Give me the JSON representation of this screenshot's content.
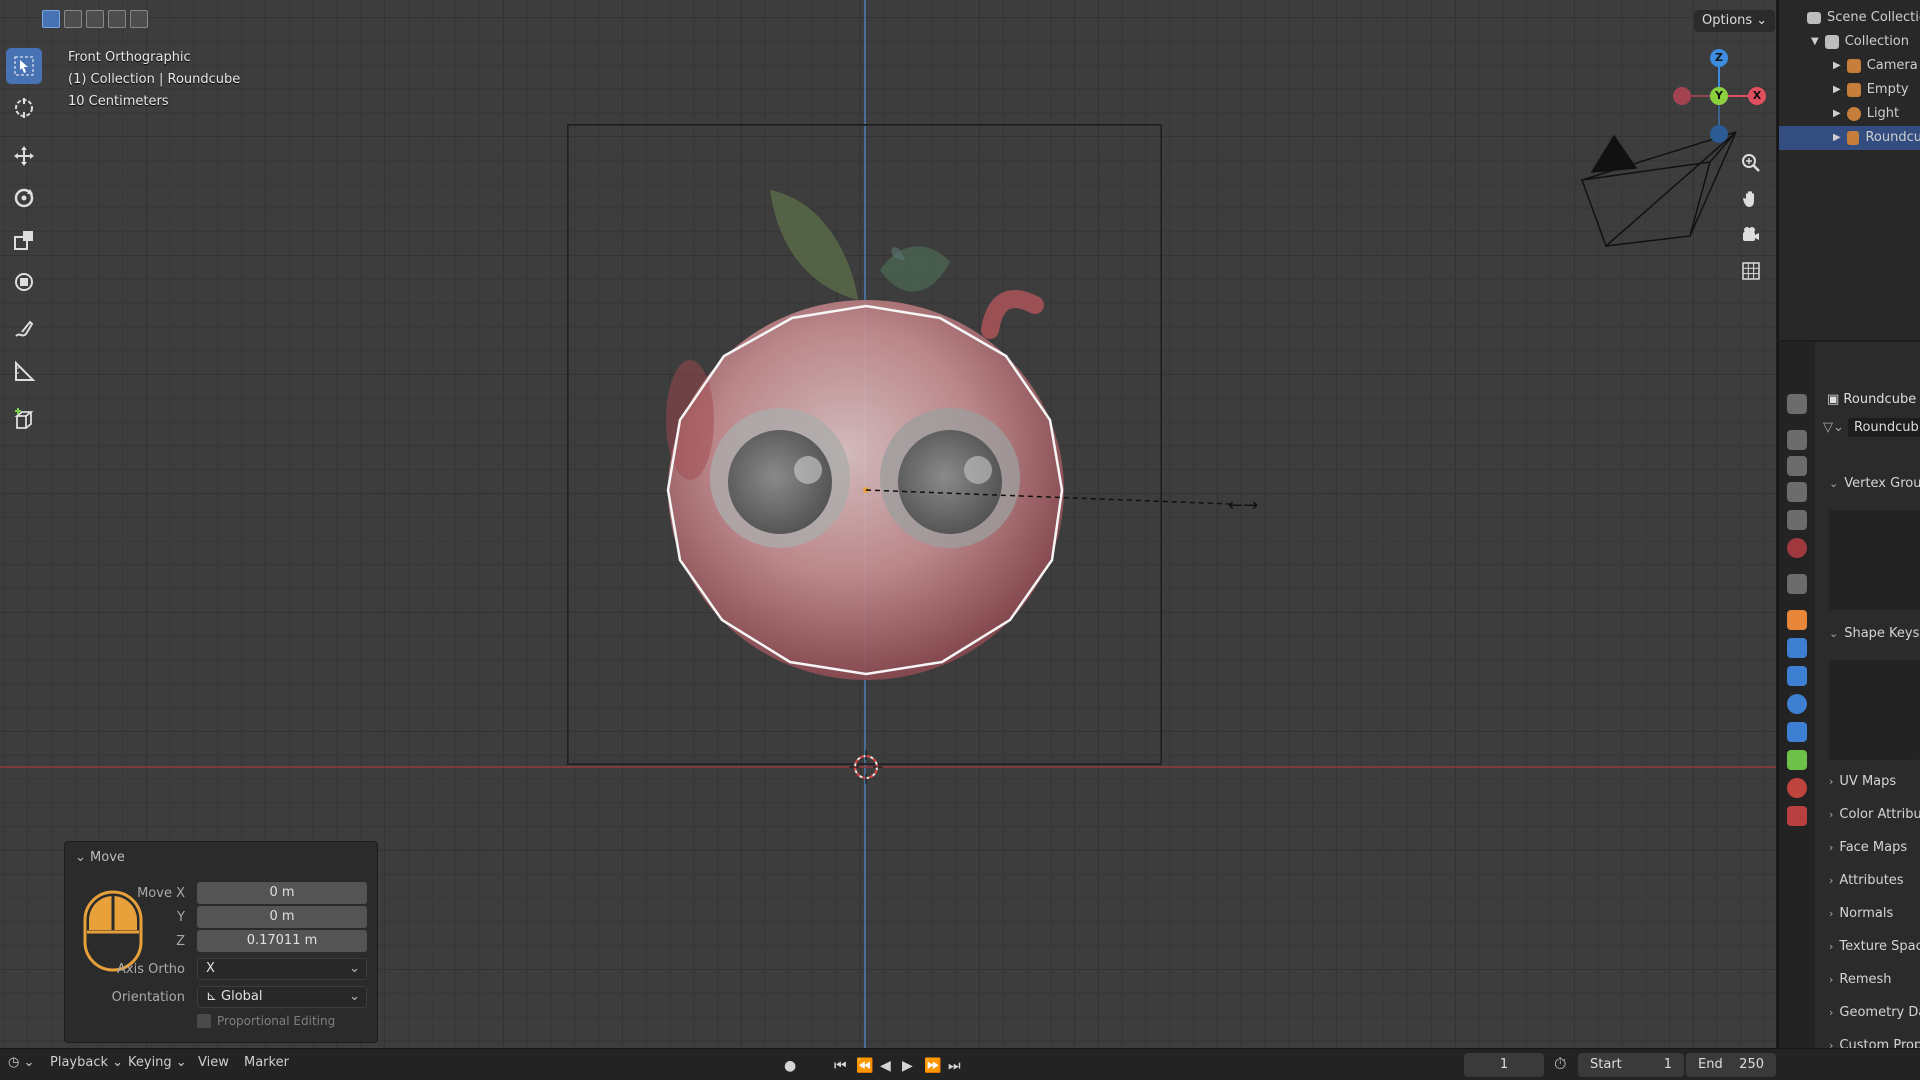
{
  "viewport": {
    "view_name": "Front Orthographic",
    "context_line": "(1) Collection | Roundcube",
    "grid_scale": "10 Centimeters"
  },
  "topbar": {
    "options_label": "Options"
  },
  "toolbar": {
    "tools": [
      "select-box",
      "cursor",
      "move",
      "rotate",
      "scale",
      "transform",
      "annotate",
      "measure",
      "add-cube"
    ]
  },
  "gizmo": {
    "axis_z": "Z",
    "axis_y": "Y",
    "axis_x": "X"
  },
  "move_panel": {
    "title": "Move",
    "move_x_label": "Move X",
    "move_x": "0 m",
    "y_label": "Y",
    "y": "0 m",
    "z_label": "Z",
    "z": "0.17011 m",
    "axis_ortho_label": "Axis Ortho",
    "axis_ortho": "X",
    "orientation_label": "Orientation",
    "orientation": "Global",
    "proportional_editing": "Proportional Editing"
  },
  "outliner": {
    "scene_collection": "Scene Collection",
    "collection": "Collection",
    "items": [
      {
        "label": "Camera",
        "icon": "camera-icon",
        "color": "#c77e3a"
      },
      {
        "label": "Empty",
        "icon": "empty-icon",
        "color": "#c77e3a"
      },
      {
        "label": "Light",
        "icon": "light-icon",
        "color": "#c77e3a"
      },
      {
        "label": "Roundcu",
        "icon": "mesh-icon",
        "color": "#c77e3a"
      }
    ]
  },
  "properties": {
    "object_name": "Roundcube",
    "mesh_name": "Roundcub",
    "vertex_groups": "Vertex Groups",
    "shape_keys": "Shape Keys",
    "sections": [
      "UV Maps",
      "Color Attribut",
      "Face Maps",
      "Attributes",
      "Normals",
      "Texture Space",
      "Remesh",
      "Geometry Da",
      "Custom Prope"
    ]
  },
  "bottombar": {
    "playback": "Playback",
    "keying": "Keying",
    "view": "View",
    "marker": "Marker",
    "current_frame": "1",
    "start_label": "Start",
    "start": "1",
    "end_label": "End",
    "end": "250"
  },
  "colors": {
    "accent": "#4772b3",
    "axis_x": "#e04f5f",
    "axis_y": "#8bd13e",
    "axis_z": "#3d8ce0",
    "outline": "#ffffff"
  }
}
